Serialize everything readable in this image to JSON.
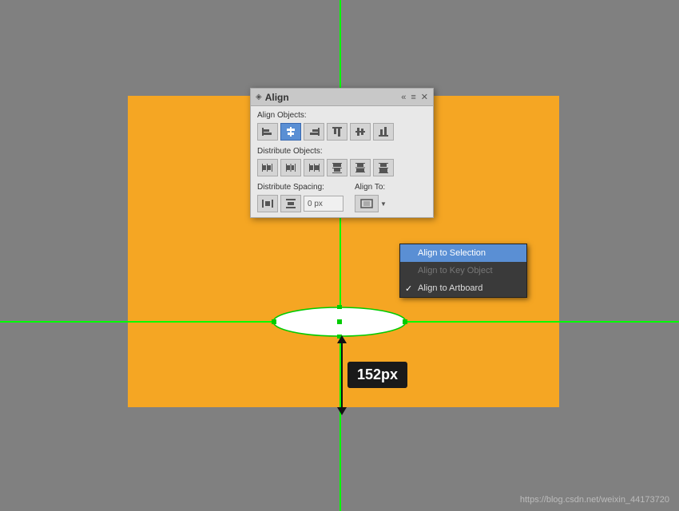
{
  "panel": {
    "title": "Align",
    "title_icon": "◈",
    "align_objects_label": "Align Objects:",
    "distribute_objects_label": "Distribute Objects:",
    "distribute_spacing_label": "Distribute Spacing:",
    "align_to_label": "Align To:",
    "spacing_value": "0 px",
    "spacing_placeholder": "0 px",
    "controls": {
      "collapse": "«",
      "menu": "≡",
      "close": "✕"
    }
  },
  "dropdown": {
    "items": [
      {
        "id": "align-to-selection",
        "label": "Align to Selection",
        "checked": false,
        "disabled": false,
        "hovered": true
      },
      {
        "id": "align-to-key-object",
        "label": "Align to Key Object",
        "checked": false,
        "disabled": true,
        "hovered": false
      },
      {
        "id": "align-to-artboard",
        "label": "Align to Artboard",
        "checked": true,
        "disabled": false,
        "hovered": false
      }
    ]
  },
  "measurement": {
    "value": "152px"
  },
  "watermark": {
    "text": "https://blog.csdn.net/weixin_44173720"
  },
  "align_objects_buttons": [
    {
      "id": "align-left",
      "label": "⊣"
    },
    {
      "id": "align-center-h",
      "label": "⊢⊣",
      "active": true
    },
    {
      "id": "align-right",
      "label": "⊢"
    },
    {
      "id": "align-top",
      "label": "⊤"
    },
    {
      "id": "align-center-v",
      "label": "⊥⊤"
    },
    {
      "id": "align-bottom",
      "label": "⊥"
    }
  ],
  "distribute_objects_buttons": [
    {
      "id": "dist-left",
      "label": "|||"
    },
    {
      "id": "dist-center-h",
      "label": "||"
    },
    {
      "id": "dist-right",
      "label": "||"
    },
    {
      "id": "dist-top",
      "label": "≡"
    },
    {
      "id": "dist-center-v",
      "label": "≡"
    },
    {
      "id": "dist-bottom",
      "label": "≡"
    }
  ],
  "distribute_spacing_buttons": [
    {
      "id": "dist-space-h",
      "label": "↔"
    },
    {
      "id": "dist-space-v",
      "label": "↕"
    }
  ]
}
